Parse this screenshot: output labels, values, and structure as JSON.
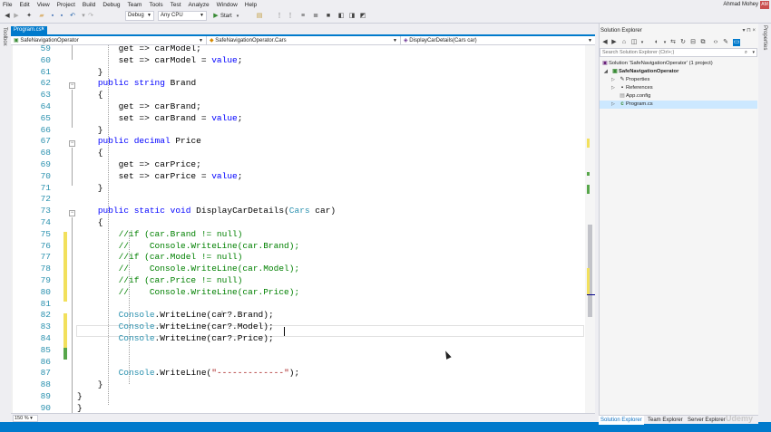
{
  "menu": [
    "File",
    "Edit",
    "View",
    "Project",
    "Build",
    "Debug",
    "Team",
    "Tools",
    "Test",
    "Analyze",
    "Window",
    "Help"
  ],
  "user": {
    "name": "Ahmad Mohey",
    "initials": "AM"
  },
  "toolbar": {
    "config": "Debug",
    "platform": "Any CPU",
    "start_label": "Start"
  },
  "left_tab": "Toolbox",
  "right_tab": "Properties",
  "doc_tab": {
    "label": "Program.cs*",
    "close": "×"
  },
  "navbar": {
    "project": "SafeNavigationOperator",
    "class": "SafeNavigationOperator.Cars",
    "member": "DisplayCarDetails(Cars car)"
  },
  "editor": {
    "lines": [
      {
        "n": "59",
        "tokens": [
          [
            "",
            "        get => carModel;"
          ]
        ]
      },
      {
        "n": "60",
        "tokens": [
          [
            "",
            "        set => carModel = "
          ],
          [
            "kw",
            "value"
          ],
          [
            "",
            ";"
          ]
        ]
      },
      {
        "n": "61",
        "tokens": [
          [
            "",
            "    }"
          ]
        ]
      },
      {
        "n": "62",
        "tokens": [
          [
            "",
            "    "
          ],
          [
            "kw",
            "public"
          ],
          [
            "",
            " "
          ],
          [
            "kw",
            "string"
          ],
          [
            "",
            " Brand"
          ]
        ]
      },
      {
        "n": "63",
        "tokens": [
          [
            "",
            "    {"
          ]
        ]
      },
      {
        "n": "64",
        "tokens": [
          [
            "",
            "        get => carBrand;"
          ]
        ]
      },
      {
        "n": "65",
        "tokens": [
          [
            "",
            "        set => carBrand = "
          ],
          [
            "kw",
            "value"
          ],
          [
            "",
            ";"
          ]
        ]
      },
      {
        "n": "66",
        "tokens": [
          [
            "",
            "    }"
          ]
        ]
      },
      {
        "n": "67",
        "tokens": [
          [
            "",
            "    "
          ],
          [
            "kw",
            "public"
          ],
          [
            "",
            " "
          ],
          [
            "kw",
            "decimal"
          ],
          [
            "",
            " Price"
          ]
        ]
      },
      {
        "n": "68",
        "tokens": [
          [
            "",
            "    {"
          ]
        ]
      },
      {
        "n": "69",
        "tokens": [
          [
            "",
            "        get => carPrice;"
          ]
        ]
      },
      {
        "n": "70",
        "tokens": [
          [
            "",
            "        set => carPrice = "
          ],
          [
            "kw",
            "value"
          ],
          [
            "",
            ";"
          ]
        ]
      },
      {
        "n": "71",
        "tokens": [
          [
            "",
            "    }"
          ]
        ]
      },
      {
        "n": "72",
        "tokens": [
          [
            "",
            ""
          ]
        ]
      },
      {
        "n": "73",
        "tokens": [
          [
            "",
            "    "
          ],
          [
            "kw",
            "public"
          ],
          [
            "",
            " "
          ],
          [
            "kw",
            "static"
          ],
          [
            "",
            " "
          ],
          [
            "kw",
            "void"
          ],
          [
            "",
            " DisplayCarDetails("
          ],
          [
            "ty",
            "Cars"
          ],
          [
            "",
            " car)"
          ]
        ]
      },
      {
        "n": "74",
        "tokens": [
          [
            "",
            "    {"
          ]
        ]
      },
      {
        "n": "75",
        "tokens": [
          [
            "cm",
            "        //if (car.Brand != null)"
          ]
        ]
      },
      {
        "n": "76",
        "tokens": [
          [
            "cm",
            "        //    Console.WriteLine(car.Brand);"
          ]
        ]
      },
      {
        "n": "77",
        "tokens": [
          [
            "cm",
            "        //if (car.Model != null)"
          ]
        ]
      },
      {
        "n": "78",
        "tokens": [
          [
            "cm",
            "        //    Console.WriteLine(car.Model);"
          ]
        ]
      },
      {
        "n": "79",
        "tokens": [
          [
            "cm",
            "        //if (car.Price != null)"
          ]
        ]
      },
      {
        "n": "80",
        "tokens": [
          [
            "cm",
            "        //    Console.WriteLine(car.Price);"
          ]
        ]
      },
      {
        "n": "81",
        "tokens": [
          [
            "",
            ""
          ]
        ]
      },
      {
        "n": "82",
        "tokens": [
          [
            "",
            "        "
          ],
          [
            "ty",
            "Console"
          ],
          [
            "",
            ".WriteLine(car?.Brand);"
          ]
        ]
      },
      {
        "n": "83",
        "tokens": [
          [
            "",
            "        "
          ],
          [
            "ty",
            "Console"
          ],
          [
            "",
            ".WriteLine(car?.Model);"
          ]
        ]
      },
      {
        "n": "84",
        "tokens": [
          [
            "",
            "        "
          ],
          [
            "ty",
            "Console"
          ],
          [
            "",
            ".WriteLine(car?.Price);"
          ]
        ]
      },
      {
        "n": "85",
        "tokens": [
          [
            "",
            ""
          ]
        ]
      },
      {
        "n": "86",
        "tokens": [
          [
            "",
            ""
          ]
        ]
      },
      {
        "n": "87",
        "tokens": [
          [
            "",
            "        "
          ],
          [
            "ty",
            "Console"
          ],
          [
            "",
            ".WriteLine("
          ],
          [
            "st",
            "\"-------------\""
          ],
          [
            "",
            ");"
          ]
        ]
      },
      {
        "n": "88",
        "tokens": [
          [
            "",
            "    }"
          ]
        ]
      },
      {
        "n": "89",
        "tokens": [
          [
            "",
            "}"
          ]
        ]
      },
      {
        "n": "90",
        "tokens": [
          [
            "",
            "}"
          ]
        ]
      }
    ]
  },
  "zoom": "150 %",
  "solution_explorer": {
    "title": "Solution Explorer",
    "search_placeholder": "Search Solution Explorer (Ctrl+;)",
    "tree": [
      {
        "label": "Solution 'SafeNavigationOperator' (1 project)",
        "icon": "solution-icon"
      },
      {
        "label": "SafeNavigationOperator",
        "icon": "csharp-project-icon"
      },
      {
        "label": "Properties",
        "icon": "wrench-icon"
      },
      {
        "label": "References",
        "icon": "references-icon"
      },
      {
        "label": "App.config",
        "icon": "config-file-icon"
      },
      {
        "label": "Program.cs",
        "icon": "csharp-file-icon"
      }
    ],
    "tabs": [
      "Solution Explorer",
      "Team Explorer",
      "Server Explorer"
    ]
  },
  "watermark": "Udemy",
  "colors": {
    "accent": "#007acc",
    "keyword": "#0000ff",
    "type": "#2b91af",
    "comment": "#008000",
    "string": "#a31515",
    "changed": "#f2e05c",
    "saved": "#57a64a"
  }
}
